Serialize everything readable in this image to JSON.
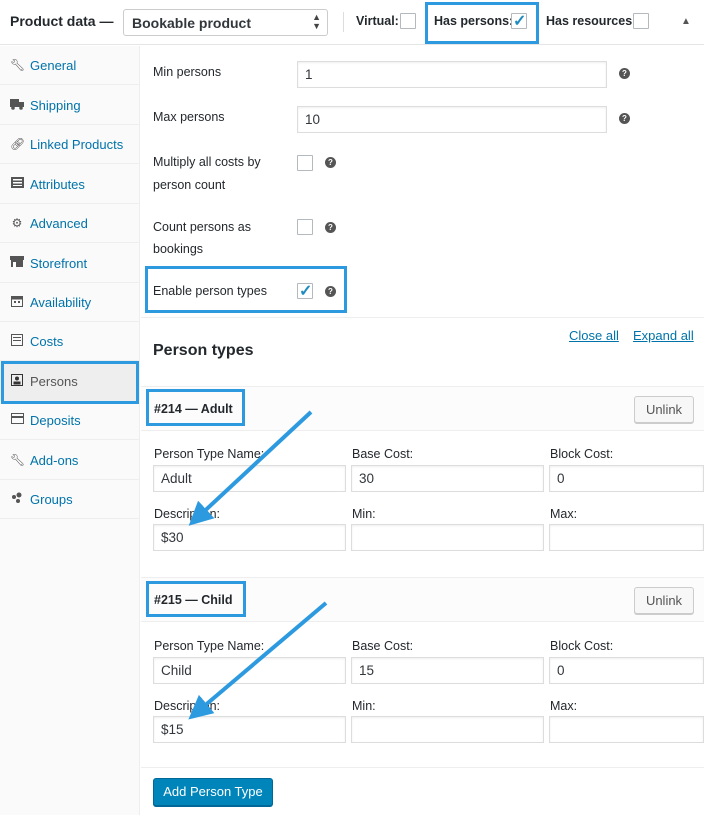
{
  "header": {
    "title": "Product data —",
    "product_type": "Bookable product",
    "virtual_label": "Virtual:",
    "virtual_checked": false,
    "has_persons_label": "Has persons:",
    "has_persons_checked": true,
    "has_resources_label": "Has resources:",
    "has_resources_checked": false
  },
  "sidebar": {
    "items": [
      {
        "label": "General",
        "icon": "wrench-icon",
        "active": false
      },
      {
        "label": "Shipping",
        "icon": "truck-icon",
        "active": false
      },
      {
        "label": "Linked Products",
        "icon": "link-icon",
        "active": false
      },
      {
        "label": "Attributes",
        "icon": "list-icon",
        "active": false
      },
      {
        "label": "Advanced",
        "icon": "gear-icon",
        "active": false
      },
      {
        "label": "Storefront",
        "icon": "store-icon",
        "active": false
      },
      {
        "label": "Availability",
        "icon": "calendar-icon",
        "active": false
      },
      {
        "label": "Costs",
        "icon": "costs-icon",
        "active": false
      },
      {
        "label": "Persons",
        "icon": "person-icon",
        "active": true
      },
      {
        "label": "Deposits",
        "icon": "deposits-icon",
        "active": false
      },
      {
        "label": "Add-ons",
        "icon": "wrench-icon",
        "active": false
      },
      {
        "label": "Groups",
        "icon": "groups-icon",
        "active": false
      }
    ]
  },
  "settings": {
    "min_persons_label": "Min persons",
    "min_persons_value": "1",
    "max_persons_label": "Max persons",
    "max_persons_value": "10",
    "multiply_label_1": "Multiply all costs by",
    "multiply_label_2": "person count",
    "multiply_checked": false,
    "count_label_1": "Count persons as",
    "count_label_2": "bookings",
    "count_checked": false,
    "enable_types_label": "Enable person types",
    "enable_types_checked": true
  },
  "person_types": {
    "title": "Person types",
    "close_all": "Close all",
    "expand_all": "Expand all",
    "unlink_label": "Unlink",
    "name_label": "Person Type Name:",
    "base_cost_label": "Base Cost:",
    "block_cost_label": "Block Cost:",
    "description_label": "Description:",
    "min_label": "Min:",
    "max_label": "Max:",
    "items": [
      {
        "heading": "#214 — Adult",
        "name": "Adult",
        "base_cost": "30",
        "block_cost": "0",
        "description": "$30",
        "min": "",
        "max": ""
      },
      {
        "heading": "#215 — Child",
        "name": "Child",
        "base_cost": "15",
        "block_cost": "0",
        "description": "$15",
        "min": "",
        "max": ""
      }
    ],
    "add_button": "Add Person Type"
  },
  "colors": {
    "highlight": "#2d9ae0",
    "link": "#0073aa",
    "primary_button": "#0085ba"
  }
}
